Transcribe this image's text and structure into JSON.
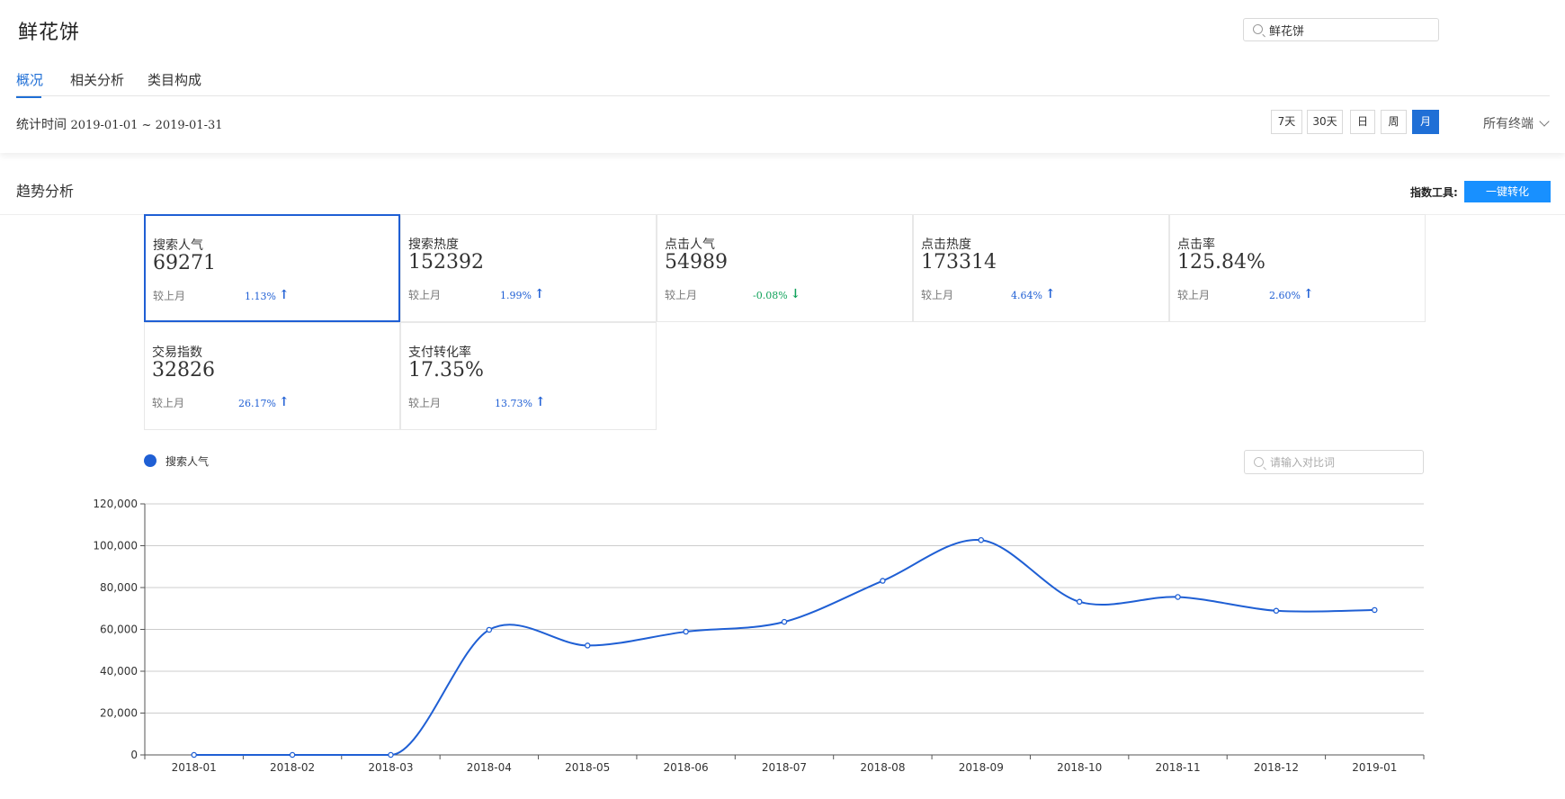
{
  "header": {
    "title": "鲜花饼",
    "search_value": "鲜花饼"
  },
  "tabs": [
    {
      "label": "概况",
      "active": true
    },
    {
      "label": "相关分析",
      "active": false
    },
    {
      "label": "类目构成",
      "active": false
    }
  ],
  "stat_time": {
    "label": "统计时间",
    "range": "2019-01-01 ~ 2019-01-31"
  },
  "range_buttons": [
    {
      "label": "7天",
      "active": false
    },
    {
      "label": "30天",
      "active": false
    },
    {
      "label": "日",
      "active": false
    },
    {
      "label": "周",
      "active": false
    },
    {
      "label": "月",
      "active": true
    }
  ],
  "terminal_label": "所有终端",
  "trend": {
    "title": "趋势分析",
    "tool_label": "指数工具:",
    "convert_label": "一键转化"
  },
  "metrics": [
    {
      "label": "搜索人气",
      "value": "69271",
      "compare": "较上月",
      "change": "1.13%",
      "direction": "up",
      "active": true
    },
    {
      "label": "搜索热度",
      "value": "152392",
      "compare": "较上月",
      "change": "1.99%",
      "direction": "up",
      "active": false
    },
    {
      "label": "点击人气",
      "value": "54989",
      "compare": "较上月",
      "change": "-0.08%",
      "direction": "down",
      "active": false
    },
    {
      "label": "点击热度",
      "value": "173314",
      "compare": "较上月",
      "change": "4.64%",
      "direction": "up",
      "active": false
    },
    {
      "label": "点击率",
      "value": "125.84%",
      "compare": "较上月",
      "change": "2.60%",
      "direction": "up",
      "active": false
    },
    {
      "label": "交易指数",
      "value": "32826",
      "compare": "较上月",
      "change": "26.17%",
      "direction": "up",
      "active": false
    },
    {
      "label": "支付转化率",
      "value": "17.35%",
      "compare": "较上月",
      "change": "13.73%",
      "direction": "up",
      "active": false
    }
  ],
  "legend_label": "搜索人气",
  "compare_placeholder": "请输入对比词",
  "colors": {
    "accent": "#1f5fd4",
    "up": "#1f5fd4",
    "down": "#11a35b",
    "convert_button": "#1890ff"
  },
  "chart_data": {
    "type": "line",
    "x": [
      "2018-01",
      "2018-02",
      "2018-03",
      "2018-04",
      "2018-05",
      "2018-06",
      "2018-07",
      "2018-08",
      "2018-09",
      "2018-10",
      "2018-11",
      "2018-12",
      "2019-01"
    ],
    "series": [
      {
        "name": "搜索人气",
        "values": [
          0,
          0,
          0,
          59800,
          52300,
          58900,
          63600,
          83200,
          102700,
          73200,
          75500,
          68900,
          69271
        ],
        "color": "#1f5fd4"
      }
    ],
    "ylim": [
      0,
      120000
    ],
    "yticks": [
      0,
      20000,
      40000,
      60000,
      80000,
      100000,
      120000
    ],
    "grid": true,
    "legend": "top-left",
    "smooth": true
  }
}
